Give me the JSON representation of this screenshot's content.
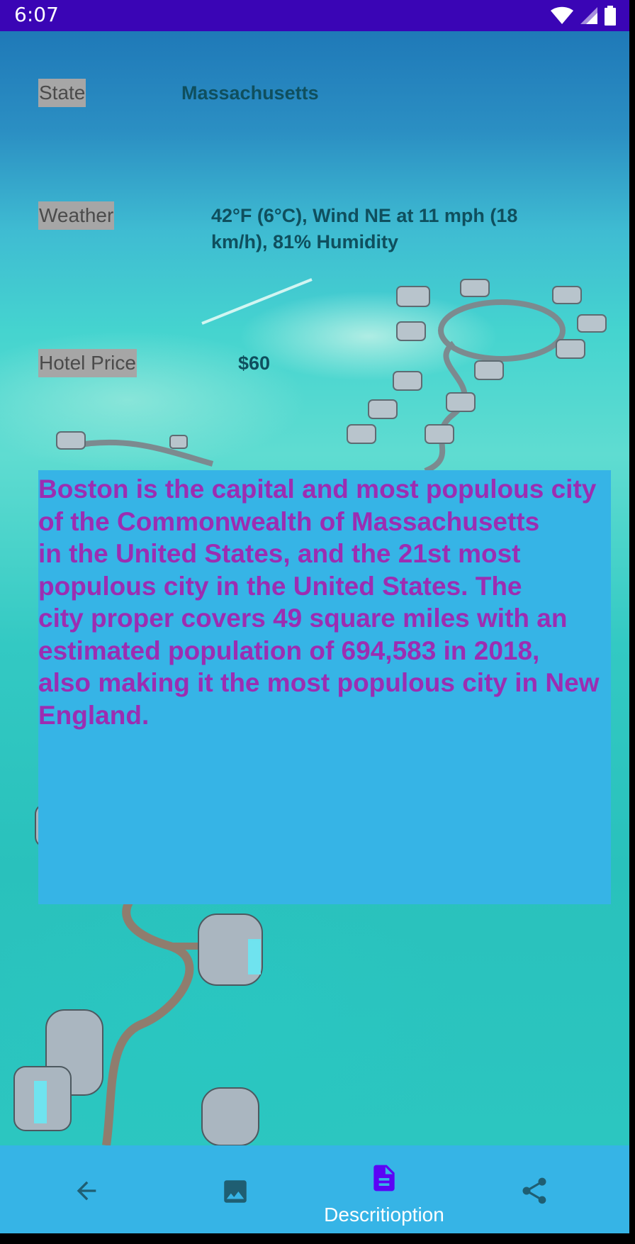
{
  "status_bar": {
    "time": "6:07"
  },
  "info": {
    "state_label": "State",
    "state_value": "Massachusetts",
    "weather_label": "Weather",
    "weather_value_line1": "42°F (6°C), Wind NE at 11 mph (18",
    "weather_value_line2": "km/h), 81% Humidity",
    "hotel_label": "Hotel Price",
    "hotel_value": "$60"
  },
  "description": {
    "lines": [
      "Boston is the capital and most populous city",
      "of the Commonwealth of Massachusetts",
      "in the United States, and the 21st most",
      "populous city in the United States. The",
      "city proper covers 49 square miles with an",
      "estimated population of 694,583 in 2018,",
      "also making it the most populous city in New",
      "England."
    ]
  },
  "bottom_nav": {
    "items": [
      {
        "icon": "arrow-back-icon",
        "label": "",
        "active": false
      },
      {
        "icon": "image-icon",
        "label": "",
        "active": false
      },
      {
        "icon": "description-icon",
        "label": "Descritioption",
        "active": true
      },
      {
        "icon": "share-icon",
        "label": "",
        "active": false
      }
    ]
  },
  "colors": {
    "status_bar": "#3a05b5",
    "panel": "#36b4e6",
    "description_text": "#9c2db2",
    "active_icon": "#5b05f5",
    "inactive_icon": "#1f5e72"
  }
}
